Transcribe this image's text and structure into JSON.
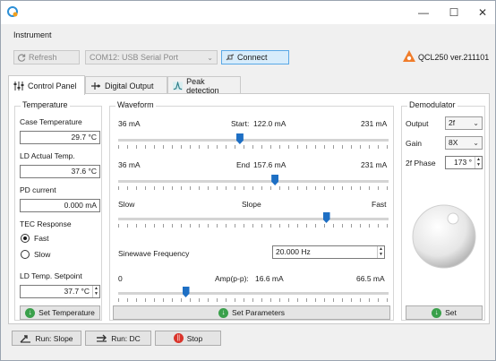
{
  "window": {
    "minimize_icon": "—",
    "maximize_icon": "☐",
    "close_icon": "✕"
  },
  "menu": {
    "instrument": "Instrument"
  },
  "toolbar": {
    "refresh": "Refresh",
    "port": "COM12: USB Serial Port",
    "connect": "Connect",
    "version": "QCL250 ver.211101"
  },
  "tabs": [
    {
      "label": "Control Panel"
    },
    {
      "label": "Digital Output"
    },
    {
      "label": "Peak detection"
    }
  ],
  "temperature": {
    "title": "Temperature",
    "case_label": "Case Temperature",
    "case_value": "29.7 °C",
    "ld_actual_label": "LD Actual Temp.",
    "ld_actual_value": "37.6 °C",
    "pd_label": "PD current",
    "pd_value": "0.000 mA",
    "tec_label": "TEC Response",
    "fast": "Fast",
    "slow": "Slow",
    "tec_selected": "Fast",
    "setpoint_label": "LD Temp. Setpoint",
    "setpoint_value": "37.7 °C",
    "set_button": "Set Temperature"
  },
  "waveform": {
    "title": "Waveform",
    "start": {
      "min": "36 mA",
      "label": "Start:",
      "value": "122.0 mA",
      "max": "231 mA",
      "fraction": 0.45
    },
    "end": {
      "min": "36 mA",
      "label": "End",
      "value": "157.6 mA",
      "max": "231 mA",
      "fraction": 0.58
    },
    "slope": {
      "min": "Slow",
      "label": "Slope",
      "max": "Fast",
      "fraction": 0.77
    },
    "sinewave_label": "Sinewave Frequency",
    "sinewave_value": "20.000 Hz",
    "amp": {
      "min": "0",
      "label": "Amp(p-p):",
      "value": "16.6 mA",
      "max": "66.5 mA",
      "fraction": 0.25
    },
    "set_button": "Set Parameters"
  },
  "demodulator": {
    "title": "Demodulator",
    "output_label": "Output",
    "output_value": "2f",
    "gain_label": "Gain",
    "gain_value": "8X",
    "phase_label": "2f Phase",
    "phase_value": "173 °",
    "set_button": "Set"
  },
  "bottom": {
    "run_slope": "Run: Slope",
    "run_dc": "Run: DC",
    "stop": "Stop"
  }
}
